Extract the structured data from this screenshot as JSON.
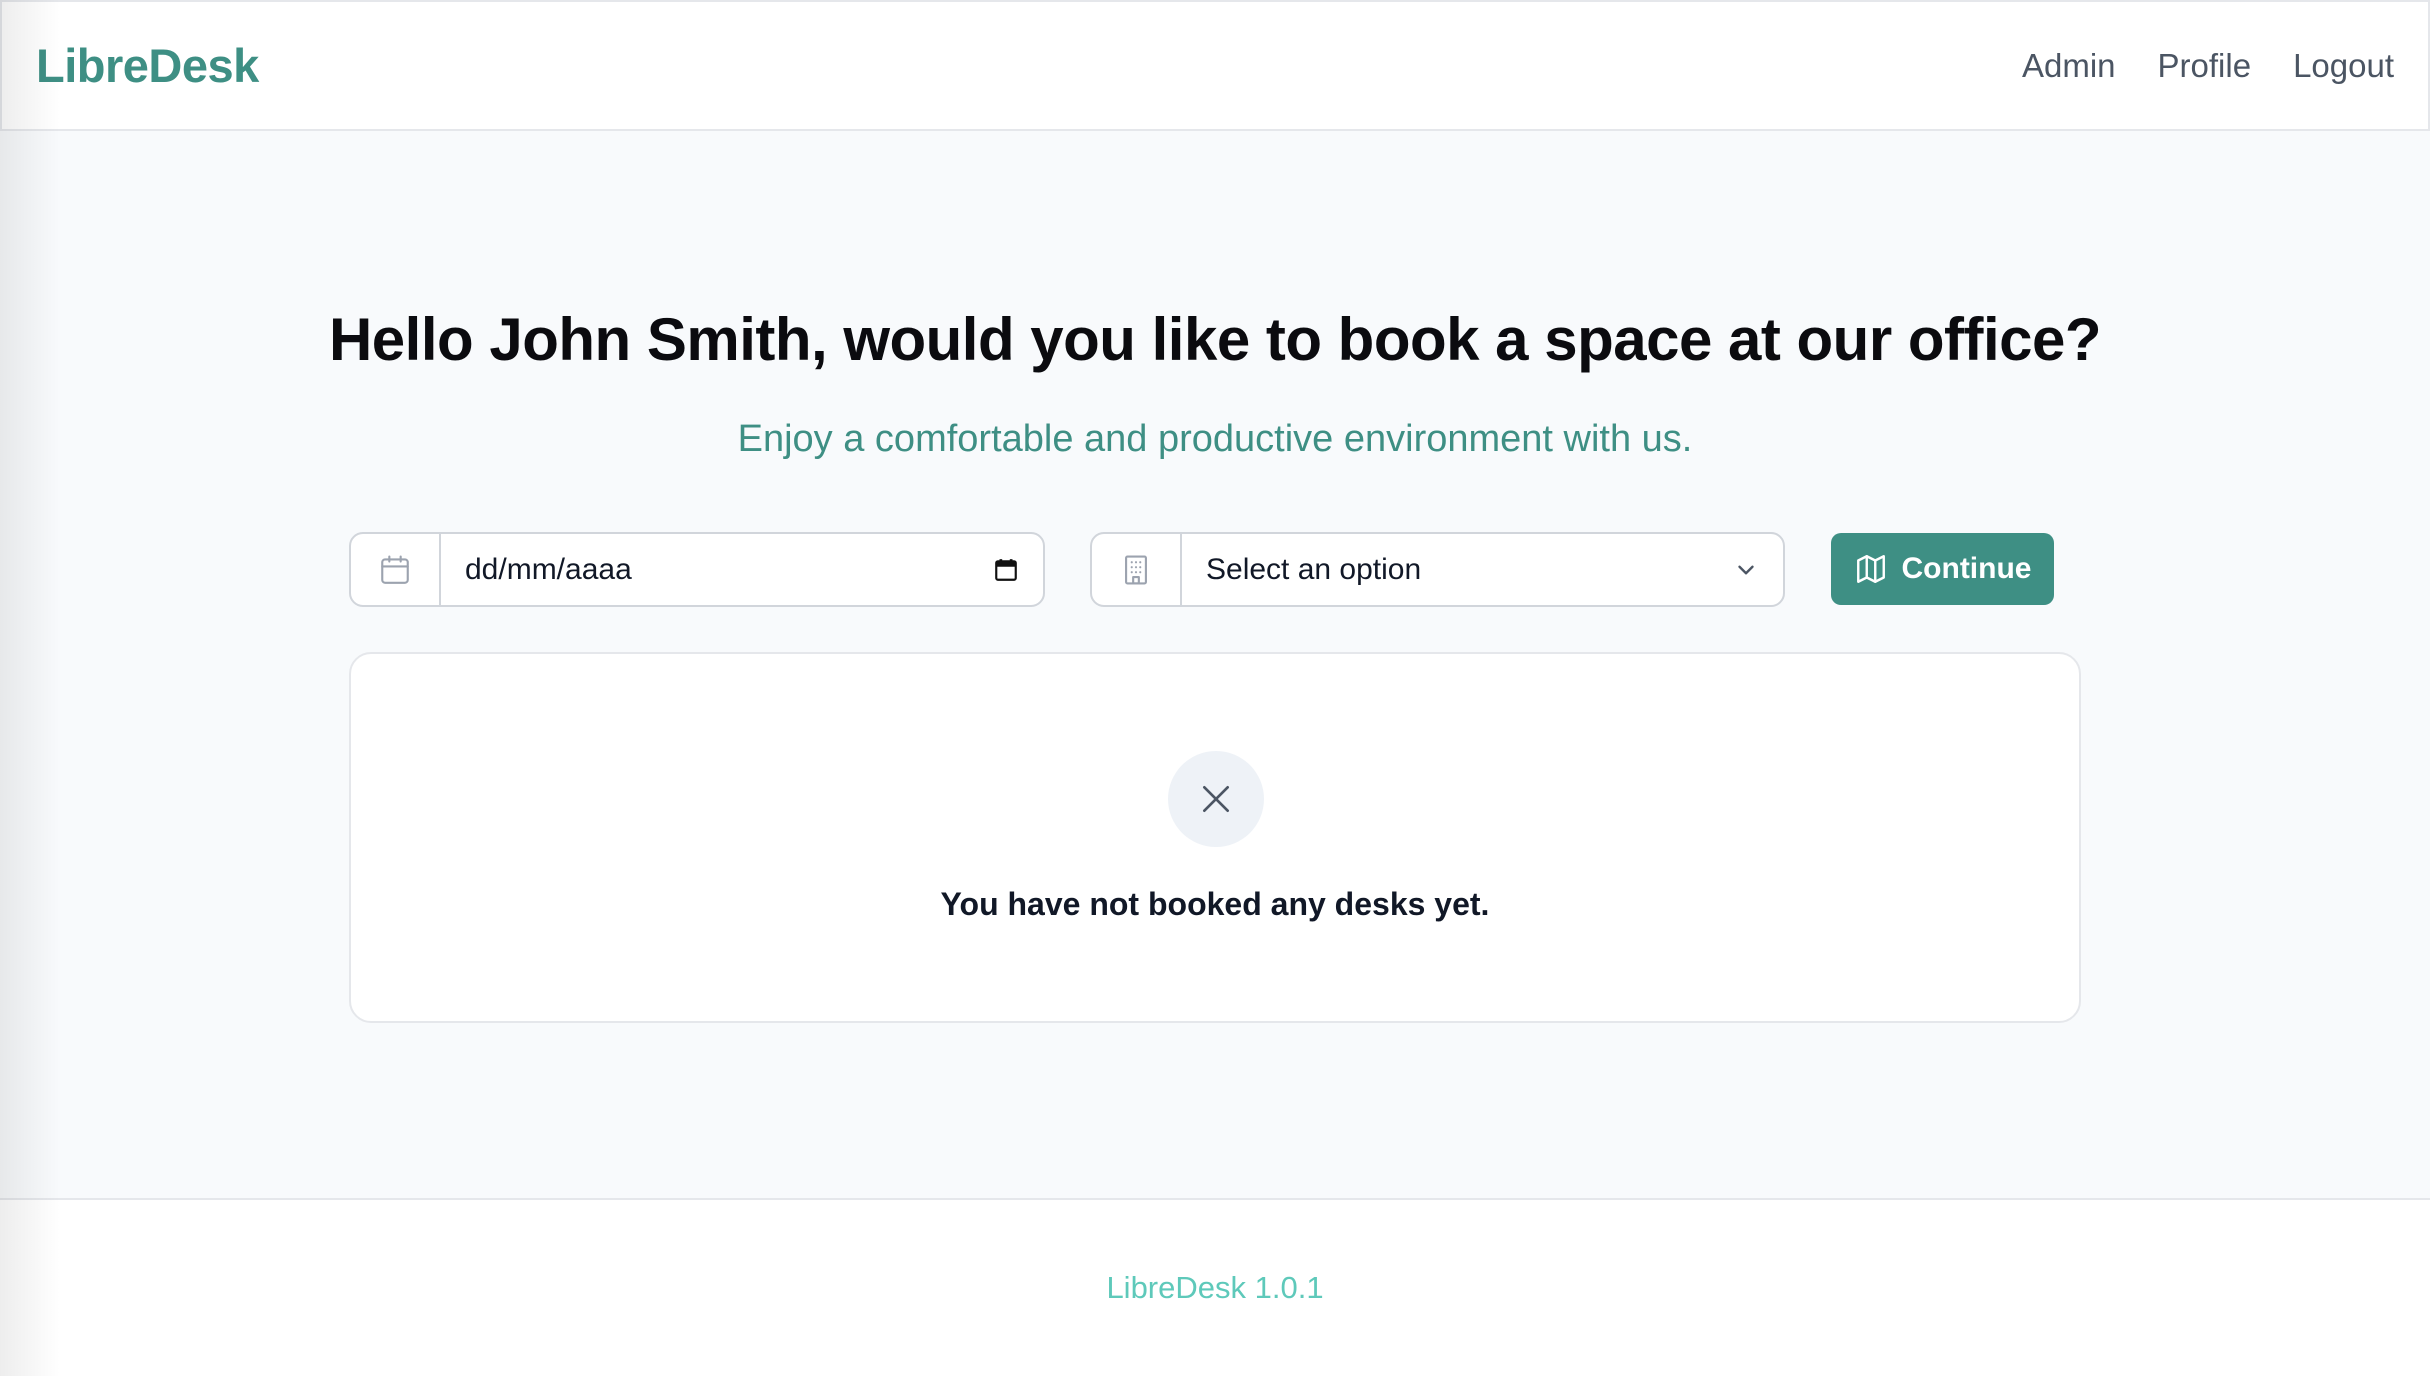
{
  "header": {
    "brand": "LibreDesk",
    "nav": [
      "Admin",
      "Profile",
      "Logout"
    ]
  },
  "hero": {
    "title": "Hello John Smith, would you like to book a space at our office?",
    "subtitle": "Enjoy a comfortable and productive environment with us."
  },
  "form": {
    "date_value": "dd/mm/aaaa",
    "select_value": "Select an option",
    "continue_label": "Continue"
  },
  "bookings": {
    "empty_message": "You have not booked any desks yet."
  },
  "footer": {
    "version": "LibreDesk 1.0.1"
  },
  "colors": {
    "brand": "#3e8f84",
    "footer_text": "#5ec9ba",
    "background": "#f8fafc"
  },
  "icons": [
    "calendar-icon",
    "building-icon",
    "calendar-picker-icon",
    "chevron-down-icon",
    "map-icon",
    "close-icon"
  ]
}
